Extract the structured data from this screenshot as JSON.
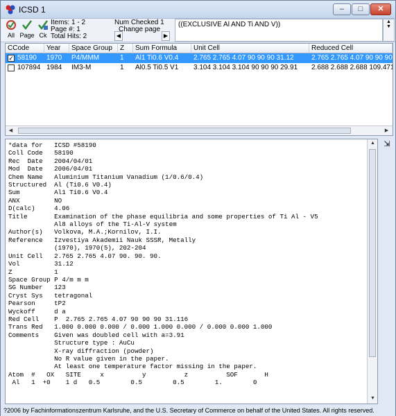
{
  "window": {
    "title": "ICSD 1",
    "controls": {
      "minimize": "–",
      "maximize": "□",
      "close": "✕"
    }
  },
  "toolbar": {
    "buttons": [
      {
        "label": "All",
        "icon": "select-all-icon"
      },
      {
        "label": "Page",
        "icon": "check-page-icon"
      },
      {
        "label": "Ck",
        "icon": "check-record-icon"
      }
    ],
    "items": "Items: 1 - 2",
    "page_no": "Page #: 1",
    "total_hits": "Total Hits: 2",
    "num_checked": "Num Checked  1",
    "change_page": "Change page",
    "query": "((EXCLUSIVE Al AND Ti AND V))"
  },
  "grid": {
    "columns": [
      "CCode",
      "Year",
      "Space Group",
      "Z",
      "Sum Formula",
      "Unit Cell",
      "Reduced Cell"
    ],
    "rows": [
      {
        "checked": true,
        "selected": true,
        "cells": [
          "58190",
          "1970",
          "P4/MMM",
          "1",
          "Al1 Ti0.6 V0.4",
          "2.765 2.765 4.07 90 90 90 31.12",
          "2.765 2.765 4.07 90 90 90 31.1"
        ]
      },
      {
        "checked": false,
        "selected": false,
        "cells": [
          "107894",
          "1984",
          "IM3-M",
          "1",
          "Al0.5 Ti0.5 V1",
          "3.104 3.104 3.104 90 90 90 29.91",
          "2.688 2.688 2.688 109.471 109"
        ]
      }
    ]
  },
  "detail": {
    "text": "*data for   ICSD #58190\nColl Code   58190\nRec  Date   2004/04/01\nMod  Date   2006/04/01\nChem Name   Aluminium Titanium Vanadium (1/0.6/0.4)\nStructured  Al (Ti0.6 V0.4)\nSum         Al1 Ti0.6 V0.4\nANX         NO\nD(calc)     4.06\nTitle       Examination of the phase equilibria and some properties of Ti Al - V5\n            Al8 alloys of the Ti-Al-V system\nAuthor(s)   Volkova, M.A.;Kornilov, I.I.\nReference   Izvestiya Akademii Nauk SSSR, Metally\n            (1970), 1970(5), 202-204\nUnit Cell   2.765 2.765 4.07 90. 90. 90.\nVol         31.12\nZ           1\nSpace Group P 4/m m m\nSG Number   123\nCryst Sys   tetragonal\nPearson     tP2\nWyckoff     d a\nRed Cell    P  2.765 2.765 4.07 90 90 90 31.116\nTrans Red   1.000 0.000 0.000 / 0.000 1.000 0.000 / 0.000 0.000 1.000\nComments    Given was doubled cell with a=3.91\n            Structure type : AuCu\n            X-ray diffraction (powder)\n            No R value given in the paper.\n            At least one temperature factor missing in the paper.\nAtom  #   OX   SITE     x          y          z          SOF       H\n Al   1  +0    1 d   0.5        0.5        0.5        1.        0"
  },
  "status": "?2006 by Fachinformationszentrum Karlsruhe, and the U.S. Secretary of Commerce on behalf of the United States.  All rights reserved."
}
